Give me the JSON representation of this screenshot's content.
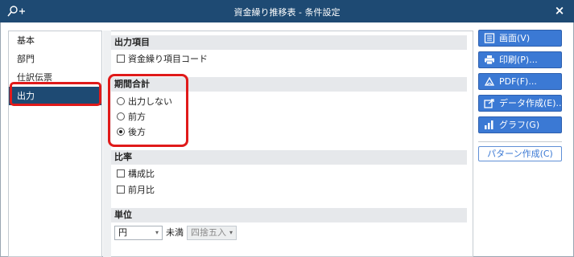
{
  "window": {
    "title": "資金繰り推移表 - 条件設定",
    "close_glyph": "×"
  },
  "sidebar": {
    "items": [
      {
        "label": "基本"
      },
      {
        "label": "部門"
      },
      {
        "label": "仕訳伝票"
      },
      {
        "label": "出力",
        "active": true
      }
    ]
  },
  "sections": {
    "output_items": {
      "title": "出力項目",
      "options": [
        {
          "label": "資金繰り項目コード",
          "checked": false
        }
      ]
    },
    "period_total": {
      "title": "期間合計",
      "options": [
        {
          "label": "出力しない",
          "selected": false
        },
        {
          "label": "前方",
          "selected": false
        },
        {
          "label": "後方",
          "selected": true
        }
      ]
    },
    "ratio": {
      "title": "比率",
      "options": [
        {
          "label": "構成比",
          "checked": false
        },
        {
          "label": "前月比",
          "checked": false
        }
      ]
    },
    "unit": {
      "title": "単位",
      "unit_select": "円",
      "threshold_label": "未満",
      "rounding_select": "四捨五入",
      "arrow_glyph": "▾"
    }
  },
  "actions": {
    "buttons": [
      {
        "label": "画面(V)",
        "icon": "screen-icon"
      },
      {
        "label": "印刷(P)...",
        "icon": "printer-icon"
      },
      {
        "label": "PDF(F)...",
        "icon": "pdf-icon"
      },
      {
        "label": "データ作成(E)...",
        "icon": "export-icon"
      },
      {
        "label": "グラフ(G)",
        "icon": "chart-icon"
      }
    ],
    "pattern_button": "パターン作成(C)"
  },
  "colors": {
    "titlebar": "#1e4a73",
    "accent": "#3b79d4",
    "highlight": "#e01a1a"
  }
}
